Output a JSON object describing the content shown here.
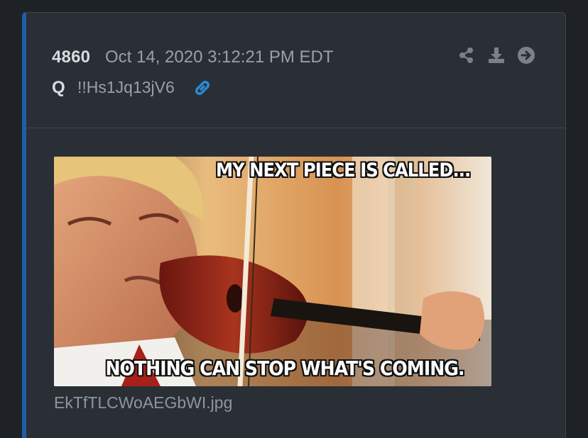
{
  "post": {
    "number": "4860",
    "date": "Oct 14, 2020 3:12:21 PM EDT",
    "author": "Q",
    "tripcode": "!!Hs1Jq13jV6"
  },
  "actions": {
    "share_icon": "share-icon",
    "download_icon": "download-icon",
    "go_icon": "arrow-circle-right-icon"
  },
  "attachment": {
    "top_caption": "MY NEXT PIECE IS CALLED...",
    "bottom_caption": "NOTHING CAN STOP WHAT'S COMING.",
    "filename": "EkTfTLCWoAEGbWI.jpg"
  },
  "colors": {
    "accent": "#1f5fa6",
    "link": "#2a8bd8",
    "card": "#2a2f36",
    "background": "#1e2227"
  }
}
